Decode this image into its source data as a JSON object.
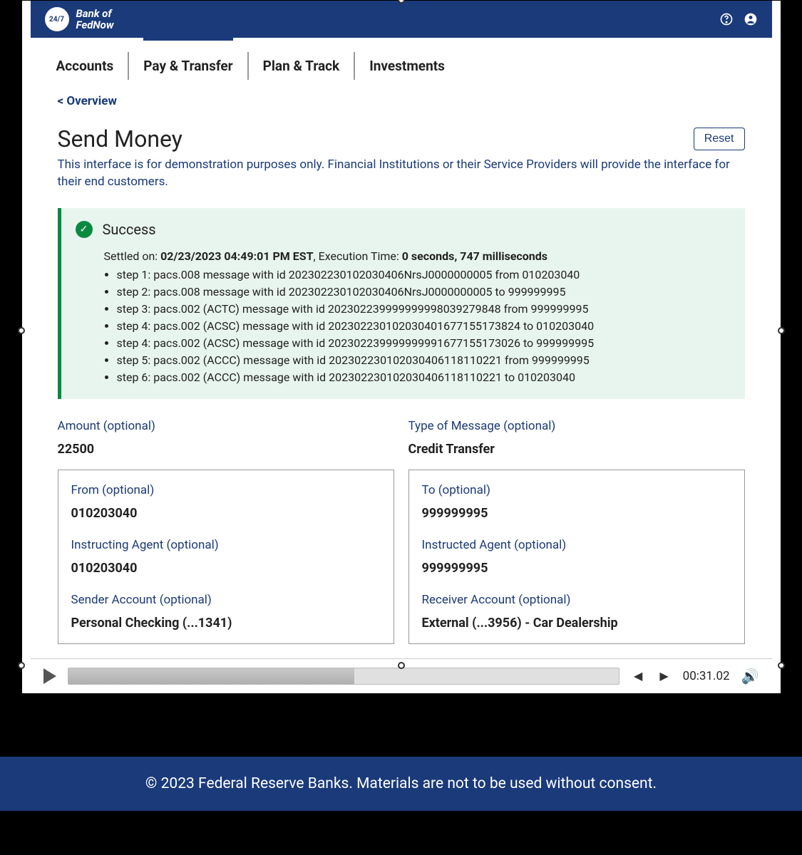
{
  "header": {
    "brand_line1": "Bank of",
    "brand_line2": "FedNow",
    "logo_text": "24/7"
  },
  "nav": {
    "tabs": [
      "Accounts",
      "Pay & Transfer",
      "Plan & Track",
      "Investments"
    ],
    "active_index": 1
  },
  "overview_link": "< Overview",
  "page_title": "Send Money",
  "reset_label": "Reset",
  "disclaimer": "This interface is for demonstration purposes only. Financial Institutions or their Service Providers will provide the interface for their end customers.",
  "success": {
    "title": "Success",
    "settled_prefix": "Settled on: ",
    "settled_time": "02/23/2023 04:49:01 PM EST",
    "exec_prefix": ", Execution Time: ",
    "exec_time": "0 seconds, 747 milliseconds",
    "steps": [
      "step 1: pacs.008 message with id 20230223010203040​6NrsJ0000000005 from 010203040",
      "step 2: pacs.008 message with id 20230223010203040​6NrsJ0000000005 to 999999995",
      "step 3: pacs.002 (ACTC) message with id 20230223999999999​8039279848 from 999999995",
      "step 4: pacs.002 (ACSC) message with id 20230223010203040​1677155173824 to 010203040",
      "step 4: pacs.002 (ACSC) message with id 20230223999999999​1677155173026 to 999999995",
      "step 5: pacs.002 (ACCC) message with id 20230223010203040​6118110221 from 999999995",
      "step 6: pacs.002 (ACCC) message with id 20230223010203040​6118110221 to 010203040"
    ]
  },
  "fields": {
    "amount_label": "Amount (optional)",
    "amount_value": "22500",
    "type_label": "Type of Message (optional)",
    "type_value": "Credit Transfer",
    "from_label": "From (optional)",
    "from_value": "010203040",
    "instructing_label": "Instructing Agent (optional)",
    "instructing_value": "010203040",
    "sender_acct_label": "Sender Account (optional)",
    "sender_acct_value": "Personal Checking (...1341)",
    "to_label": "To (optional)",
    "to_value": "999999995",
    "instructed_label": "Instructed Agent (optional)",
    "instructed_value": "999999995",
    "receiver_acct_label": "Receiver Account (optional)",
    "receiver_acct_value": "External (...3956) - Car Dealership"
  },
  "player": {
    "time": "00:31.02"
  },
  "footer": "© 2023 Federal Reserve Banks. Materials are not to be used without consent."
}
